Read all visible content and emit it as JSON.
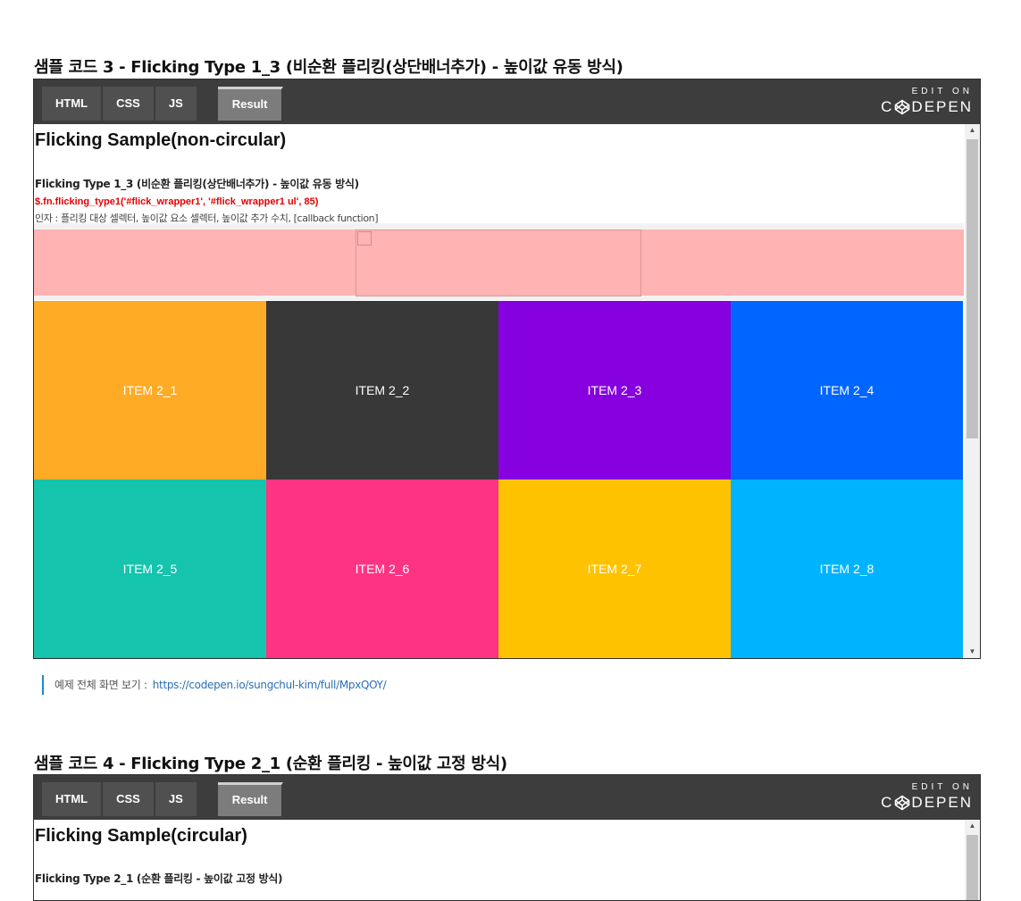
{
  "section3": {
    "title": "샘플 코드 3 - Flicking Type 1_3 (비순환 플리킹(상단배너추가) - 높이값 유동 방식)",
    "tabs": [
      "HTML",
      "CSS",
      "JS"
    ],
    "result_tab": "Result",
    "brand_top": "EDIT ON",
    "brand_left": "C",
    "brand_right": "DEPEN",
    "sample_heading": "Flicking Sample(non-circular)",
    "sample_subtitle": "Flicking Type 1_3 (비순환 플리킹(상단배너추가) - 높이값 유동 방식)",
    "code_line": "$.fn.flicking_type1('#flick_wrapper1', '#flick_wrapper1 ul', 85)",
    "args_line": "인자 : 플리킹 대상 셀렉터, 높이값 요소 셀렉터, 높이값 추가 수치, [callback function]",
    "items": [
      {
        "label": "ITEM 2_1",
        "color": "#ffab26"
      },
      {
        "label": "ITEM 2_2",
        "color": "#383838"
      },
      {
        "label": "ITEM 2_3",
        "color": "#8600e0"
      },
      {
        "label": "ITEM 2_4",
        "color": "#0066ff"
      },
      {
        "label": "ITEM 2_5",
        "color": "#14c4ad"
      },
      {
        "label": "ITEM 2_6",
        "color": "#ff3383"
      },
      {
        "label": "ITEM 2_7",
        "color": "#ffc200"
      },
      {
        "label": "ITEM 2_8",
        "color": "#00b3ff"
      }
    ],
    "banner_color": "#ffb3b3"
  },
  "example_link": {
    "label": "예제 전체 화면 보기 :",
    "url": "https://codepen.io/sungchul-kim/full/MpxQOY/"
  },
  "section4": {
    "title": "샘플 코드 4 - Flicking Type 2_1 (순환 플리킹 - 높이값 고정 방식)",
    "tabs": [
      "HTML",
      "CSS",
      "JS"
    ],
    "result_tab": "Result",
    "brand_top": "EDIT ON",
    "brand_left": "C",
    "brand_right": "DEPEN",
    "sample_heading": "Flicking Sample(circular)",
    "sample_subtitle": "Flicking Type 2_1 (순환 플리킹 - 높이값 고정 방식)"
  },
  "icons": [
    "codepen-logo-icon",
    "scroll-up-arrow-icon",
    "scroll-down-arrow-icon"
  ]
}
